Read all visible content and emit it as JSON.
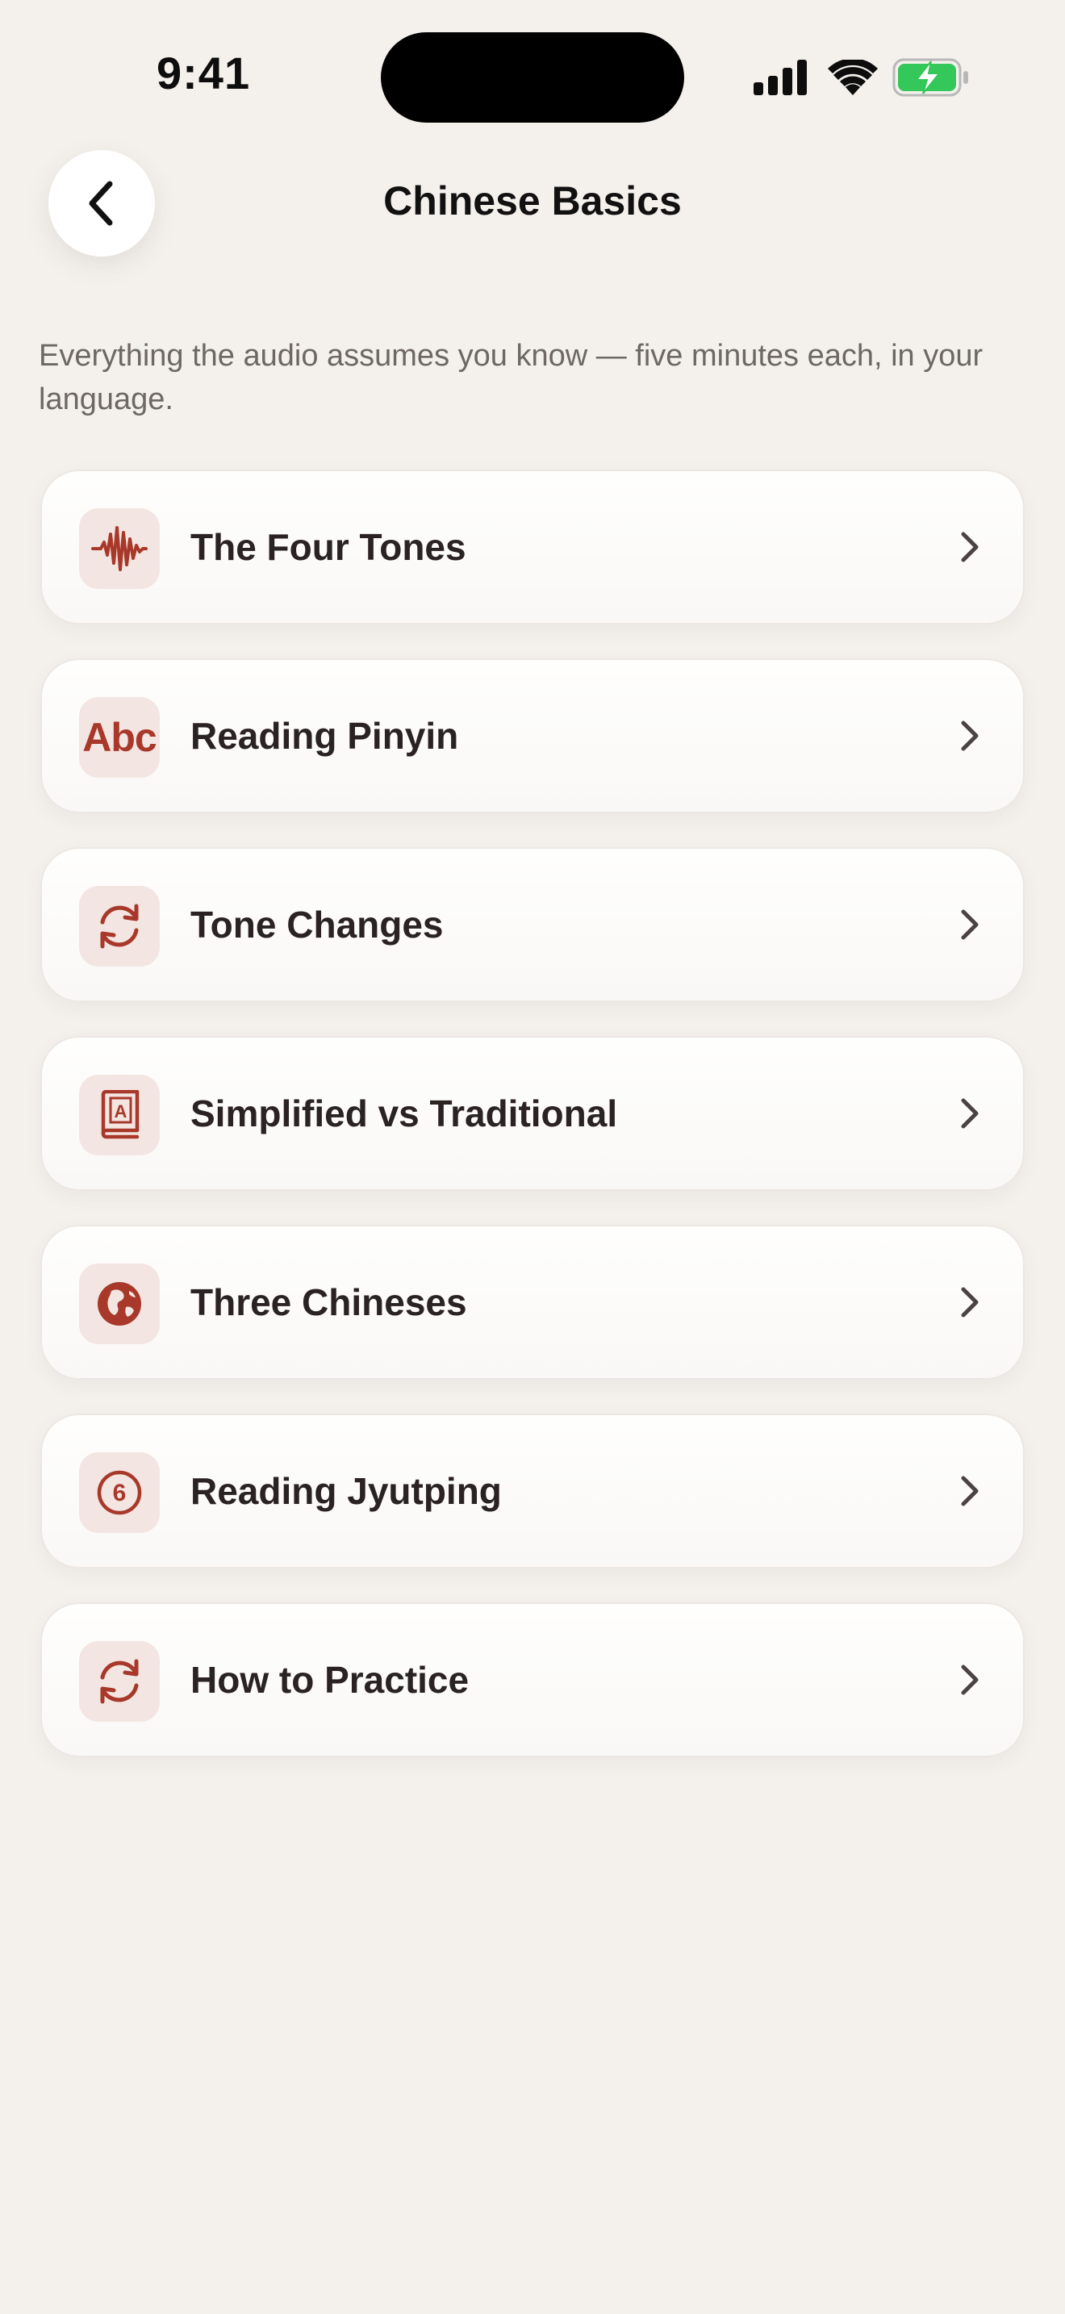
{
  "status_bar": {
    "time": "9:41"
  },
  "header": {
    "title": "Chinese Basics",
    "back_icon": "chevron-left-icon"
  },
  "intro": "Everything the audio assumes you know — five minutes each, in your language.",
  "colors": {
    "accent": "#a8382a",
    "icon_tile": "#f3e5e1",
    "background": "#f4f1ed",
    "battery_green": "#34c759"
  },
  "lessons": [
    {
      "label": "The Four Tones",
      "icon": "waveform-icon"
    },
    {
      "label": "Reading Pinyin",
      "icon": "abc-icon",
      "glyph": "Abc"
    },
    {
      "label": "Tone Changes",
      "icon": "refresh-arrows-icon"
    },
    {
      "label": "Simplified vs Traditional",
      "icon": "character-book-icon",
      "glyph": "A"
    },
    {
      "label": "Three Chineses",
      "icon": "globe-asia-icon"
    },
    {
      "label": "Reading Jyutping",
      "icon": "six-circle-icon",
      "glyph": "6"
    },
    {
      "label": "How to Practice",
      "icon": "refresh-arrows-icon"
    }
  ]
}
